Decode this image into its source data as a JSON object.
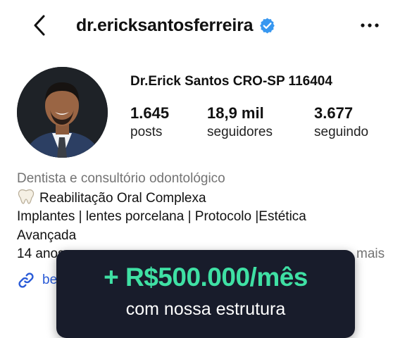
{
  "header": {
    "handle": "dr.ericksantosferreira",
    "back_icon": "chevron-left-icon",
    "verified_icon": "verified-badge-icon",
    "more_icon": "more-horizontal-icon"
  },
  "profile": {
    "name": "Dr.Erick Santos CRO-SP 116404",
    "stats": [
      {
        "value": "1.645",
        "label": "posts"
      },
      {
        "value": "18,9 mil",
        "label": "seguidores"
      },
      {
        "value": "3.677",
        "label": "seguindo"
      }
    ]
  },
  "bio": {
    "category": "Dentista e consultório odontológico",
    "line1": "Reabilitação Oral Complexa",
    "line2": "Implantes | lentes porcelana | Protocolo |Estética",
    "line3": "Avançada",
    "line4": "14 anos",
    "more": "mais",
    "link": "be"
  },
  "promo": {
    "title": "+ R$500.000/mês",
    "subtitle": "com nossa estrutura"
  },
  "colors": {
    "verified": "#3797f0",
    "link": "#2a5bd7",
    "promo_bg": "#181c2b",
    "promo_accent": "#3fe0a4",
    "muted": "#737373"
  }
}
